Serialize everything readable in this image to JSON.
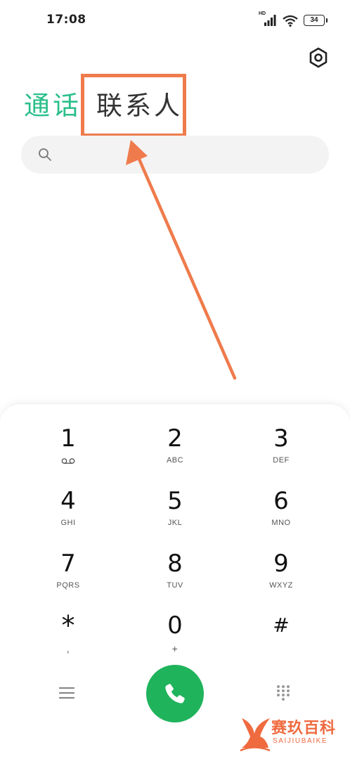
{
  "status_bar": {
    "time": "17:08",
    "network_label": "HD",
    "battery": "34",
    "icons": [
      "signal-icon",
      "wifi-icon",
      "battery-icon"
    ]
  },
  "header": {
    "settings_icon": "gear-icon"
  },
  "tabs": [
    {
      "label": "通话",
      "active": true
    },
    {
      "label": "联系人",
      "active": false
    }
  ],
  "search": {
    "placeholder": "",
    "value": ""
  },
  "dialpad": {
    "keys": [
      {
        "digit": "1",
        "sub": ""
      },
      {
        "digit": "2",
        "sub": "ABC"
      },
      {
        "digit": "3",
        "sub": "DEF"
      },
      {
        "digit": "4",
        "sub": "GHI"
      },
      {
        "digit": "5",
        "sub": "JKL"
      },
      {
        "digit": "6",
        "sub": "MNO"
      },
      {
        "digit": "7",
        "sub": "PQRS"
      },
      {
        "digit": "8",
        "sub": "TUV"
      },
      {
        "digit": "9",
        "sub": "WXYZ"
      },
      {
        "digit": "*",
        "sub": ","
      },
      {
        "digit": "0",
        "sub": "+"
      },
      {
        "digit": "#",
        "sub": ""
      }
    ]
  },
  "bottom_bar": {
    "menu_icon": "menu-icon",
    "call_icon": "phone-icon",
    "dialpad_icon": "dialpad-grid-icon"
  },
  "watermark": {
    "title": "赛玖百科",
    "subtitle": "SAIJIUBAIKE"
  },
  "colors": {
    "accent_green": "#2bbf8a",
    "call_green": "#1fb35c",
    "annotation_orange": "#ef7b4c"
  }
}
